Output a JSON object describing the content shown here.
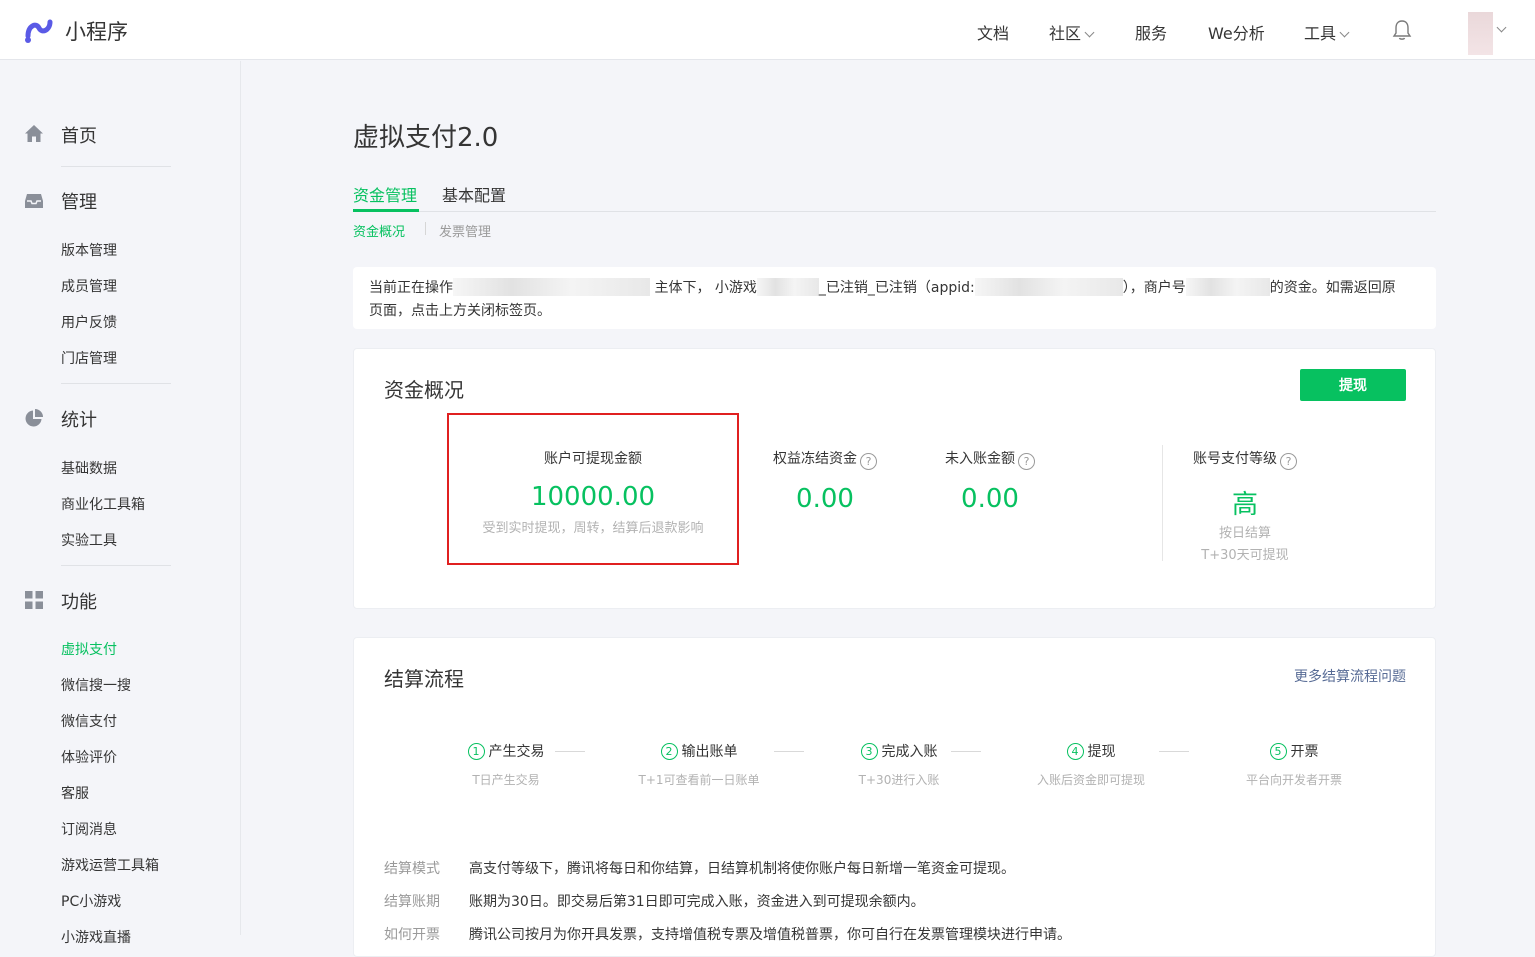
{
  "topbar": {
    "logo_text": "小程序",
    "nav": [
      {
        "label": "文档",
        "has_dropdown": false
      },
      {
        "label": "社区",
        "has_dropdown": true
      },
      {
        "label": "服务",
        "has_dropdown": false
      },
      {
        "label": "We分析",
        "has_dropdown": false
      },
      {
        "label": "工具",
        "has_dropdown": true
      }
    ],
    "icons": [
      "bell-icon",
      "chevron-down-icon"
    ]
  },
  "sidebar": {
    "groups": [
      {
        "title": "首页",
        "icon": "home-icon",
        "items": []
      },
      {
        "title": "管理",
        "icon": "inbox-icon",
        "items": [
          "版本管理",
          "成员管理",
          "用户反馈",
          "门店管理"
        ]
      },
      {
        "title": "统计",
        "icon": "pie-chart-icon",
        "items": [
          "基础数据",
          "商业化工具箱",
          "实验工具"
        ]
      },
      {
        "title": "功能",
        "icon": "grid-icon",
        "items": [
          "虚拟支付",
          "微信搜一搜",
          "微信支付",
          "体验评价",
          "客服",
          "订阅消息",
          "游戏运营工具箱",
          "PC小游戏",
          "小游戏直播"
        ]
      }
    ],
    "active_item": "虚拟支付"
  },
  "main": {
    "title": "虚拟支付2.0",
    "tabs": [
      {
        "label": "资金管理",
        "active": true
      },
      {
        "label": "基本配置",
        "active": false
      }
    ],
    "subtabs": [
      {
        "label": "资金概况",
        "active": true
      },
      {
        "label": "发票管理",
        "active": false
      }
    ],
    "notice": {
      "p1": "当前正在操作",
      "p2": "主体下， 小游戏",
      "p3": "_已注销_已注销（appid:",
      "p4": "），商户号",
      "p5": "的资金。如需返回原",
      "p6": "页面，点击上方关闭标签页。"
    },
    "overview": {
      "title": "资金概况",
      "withdraw_button": "提现",
      "stats": [
        {
          "label": "账户可提现金额",
          "value": "10000.00",
          "note": "受到实时提现，周转，结算后退款影响"
        },
        {
          "label": "权益冻结资金",
          "value": "0.00"
        },
        {
          "label": "未入账金额",
          "value": "0.00"
        },
        {
          "label": "账号支付等级",
          "value": "高",
          "note1": "按日结算",
          "note2": "T+30天可提现"
        }
      ],
      "help_glyph": "?"
    },
    "settlement": {
      "title": "结算流程",
      "more_link": "更多结算流程问题",
      "steps": [
        {
          "num": "1",
          "label": "产生交易",
          "sub": "T日产生交易"
        },
        {
          "num": "2",
          "label": "输出账单",
          "sub": "T+1可查看前一日账单"
        },
        {
          "num": "3",
          "label": "完成入账",
          "sub": "T+30进行入账"
        },
        {
          "num": "4",
          "label": "提现",
          "sub": "入账后资金即可提现"
        },
        {
          "num": "5",
          "label": "开票",
          "sub": "平台向开发者开票"
        }
      ],
      "info": [
        {
          "key": "结算模式",
          "value": "高支付等级下，腾讯将每日和你结算，日结算机制将使你账户每日新增一笔资金可提现。"
        },
        {
          "key": "结算账期",
          "value": "账期为30日。即交易后第31日即可完成入账，资金进入到可提现余额内。"
        },
        {
          "key": "如何开票",
          "value": "腾讯公司按月为你开具发票，支持增值税专票及增值税普票，你可自行在发票管理模块进行申请。"
        }
      ]
    }
  },
  "colors": {
    "accent": "#07c160",
    "link": "#576b95",
    "highlight": "#e02020"
  }
}
